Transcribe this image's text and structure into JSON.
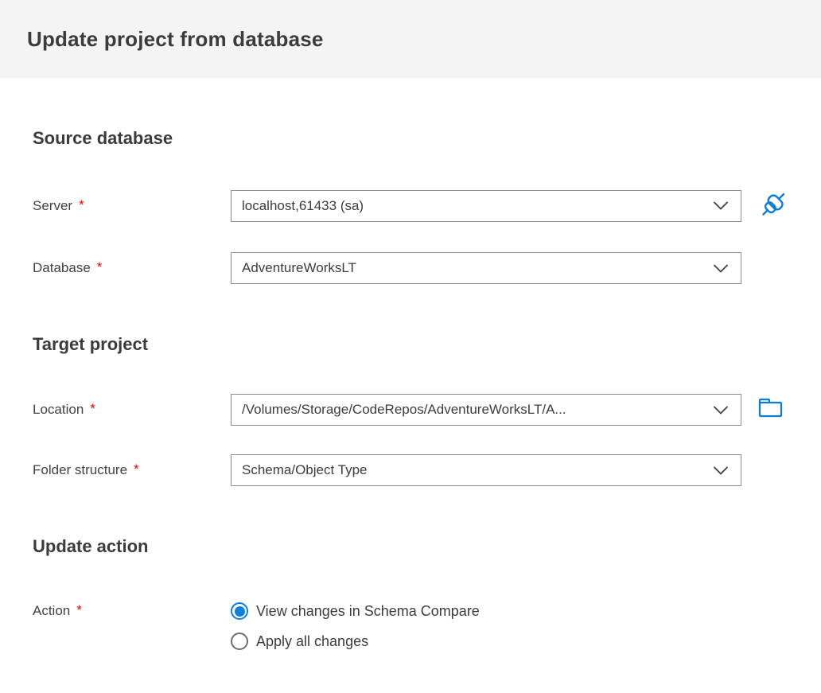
{
  "required_marker": "*",
  "colors": {
    "accent_blue": "#0c7bd8",
    "radio_blue": "#0c80dd",
    "required_red": "#eb0000",
    "header_background": "#f4f4f4",
    "text": "#3c3c3c",
    "dropdown_border": "#8a8a8a"
  },
  "header": {
    "title": "Update project from database"
  },
  "sections": [
    {
      "heading": "Source database",
      "fields": [
        {
          "label": "Server",
          "required": true,
          "control": "dropdown",
          "value": "localhost,61433 (sa)",
          "trailing_icon": "connect-icon"
        },
        {
          "label": "Database",
          "required": true,
          "control": "dropdown",
          "value": "AdventureWorksLT"
        }
      ]
    },
    {
      "heading": "Target project",
      "fields": [
        {
          "label": "Location",
          "required": true,
          "control": "dropdown",
          "value": "/Volumes/Storage/CodeRepos/AdventureWorksLT/A...",
          "trailing_icon": "folder-icon"
        },
        {
          "label": "Folder structure",
          "required": true,
          "control": "dropdown",
          "value": "Schema/Object Type"
        }
      ]
    },
    {
      "heading": "Update action",
      "fields": [
        {
          "label": "Action",
          "required": true,
          "control": "radio-group",
          "options": [
            {
              "label": "View changes in Schema Compare",
              "selected": true
            },
            {
              "label": "Apply all changes",
              "selected": false
            }
          ]
        }
      ]
    }
  ]
}
